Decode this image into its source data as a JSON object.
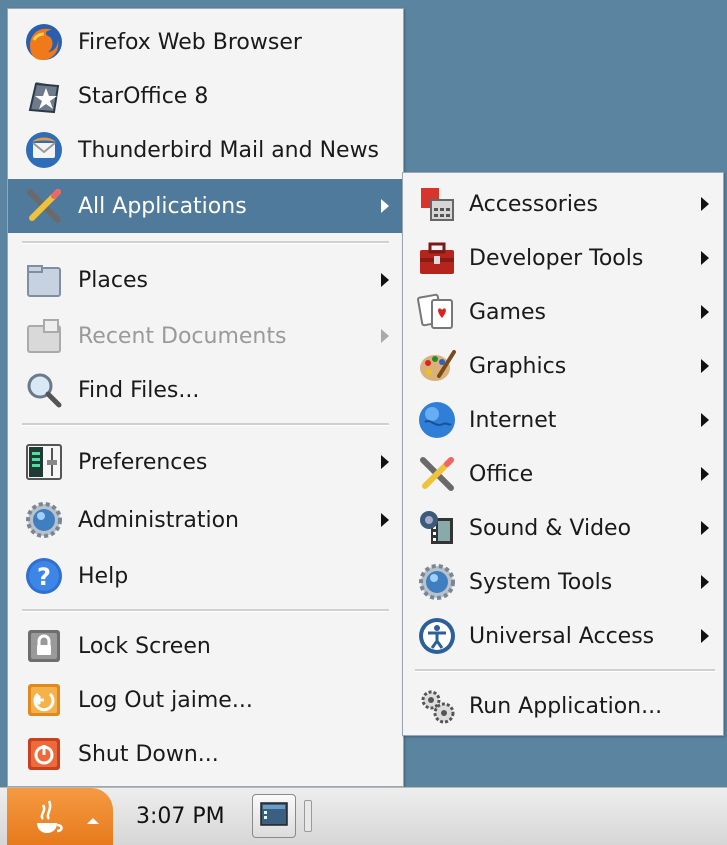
{
  "main_menu": {
    "items": [
      {
        "label": "Firefox Web Browser",
        "icon": "firefox-icon"
      },
      {
        "label": "StarOffice 8",
        "icon": "staroffice-icon"
      },
      {
        "label": "Thunderbird Mail and News",
        "icon": "thunderbird-icon"
      },
      {
        "label": "All Applications",
        "icon": "all-applications-icon",
        "state": "selected"
      },
      {
        "label": "Places",
        "icon": "places-icon"
      },
      {
        "label": "Recent Documents",
        "icon": "recent-documents-icon",
        "state": "disabled"
      },
      {
        "label": "Find Files...",
        "icon": "search-icon"
      },
      {
        "label": "Preferences",
        "icon": "preferences-icon"
      },
      {
        "label": "Administration",
        "icon": "administration-icon"
      },
      {
        "label": "Help",
        "icon": "help-icon"
      },
      {
        "label": "Lock Screen",
        "icon": "lock-icon"
      },
      {
        "label": "Log Out jaime...",
        "icon": "logout-icon"
      },
      {
        "label": "Shut Down...",
        "icon": "shutdown-icon"
      }
    ]
  },
  "submenu": {
    "items": [
      {
        "label": "Accessories",
        "icon": "accessories-icon"
      },
      {
        "label": "Developer Tools",
        "icon": "developer-tools-icon"
      },
      {
        "label": "Games",
        "icon": "games-icon"
      },
      {
        "label": "Graphics",
        "icon": "graphics-icon"
      },
      {
        "label": "Internet",
        "icon": "internet-icon"
      },
      {
        "label": "Office",
        "icon": "office-icon"
      },
      {
        "label": "Sound & Video",
        "icon": "sound-video-icon"
      },
      {
        "label": "System Tools",
        "icon": "system-tools-icon"
      },
      {
        "label": "Universal Access",
        "icon": "universal-access-icon"
      },
      {
        "label": "Run Application...",
        "icon": "run-application-icon"
      }
    ]
  },
  "panel": {
    "clock": "3:07 PM",
    "start_icon": "java-icon",
    "show_desktop_icon": "show-desktop-icon"
  },
  "colors": {
    "desktop": "#5b84a1",
    "selection": "#4f7a9b",
    "panel_start": "#e77a1c",
    "menu_bg": "#f4f4f4"
  }
}
